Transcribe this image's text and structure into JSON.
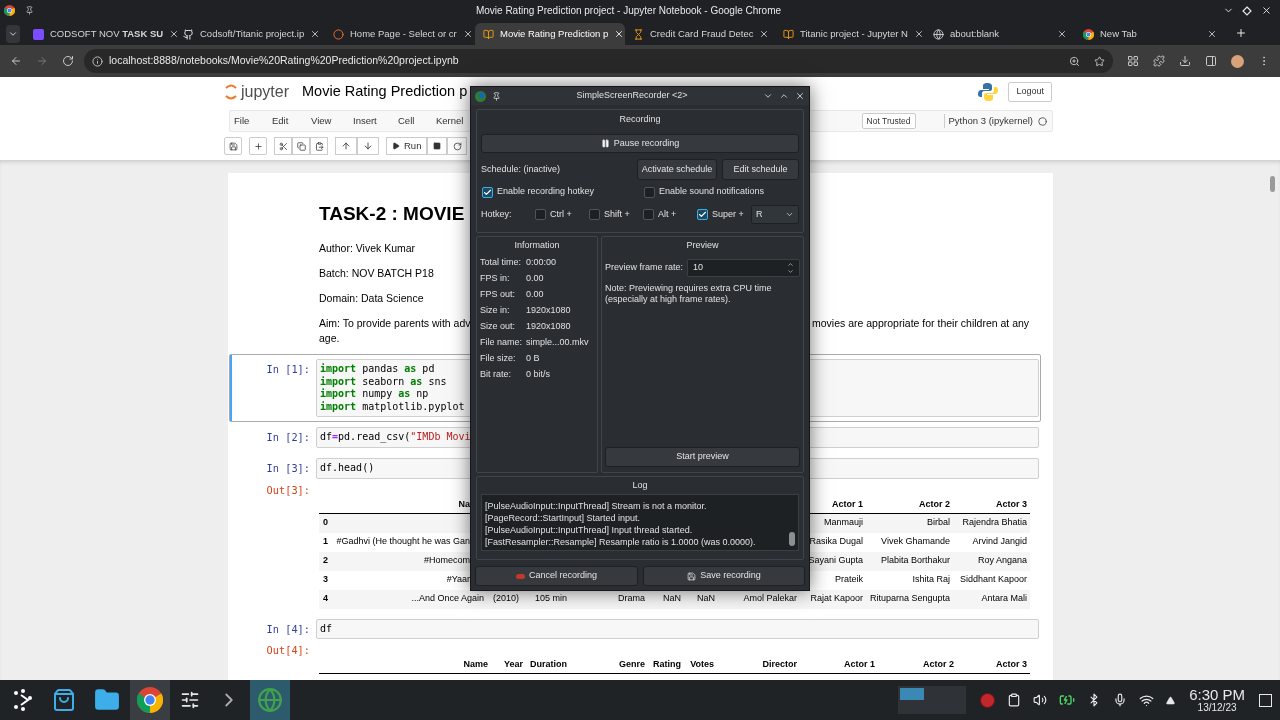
{
  "browser": {
    "window_title": "Movie Rating Prediction project - Jupyter Notebook - Google Chrome",
    "tabs": [
      {
        "title": "CODSOFT NOV **TASK SU**",
        "kind": "page",
        "selected": false
      },
      {
        "title": "Codsoft/Titanic project.ip",
        "kind": "github",
        "selected": false
      },
      {
        "title": "Home Page - Select or cr",
        "kind": "jupyter",
        "selected": false
      },
      {
        "title": "Movie Rating Prediction p",
        "kind": "notebook",
        "selected": true
      },
      {
        "title": "Credit Card Fraud Detec",
        "kind": "hourglass",
        "selected": false
      },
      {
        "title": "Titanic project - Jupyter N",
        "kind": "notebook",
        "selected": false
      },
      {
        "title": "about:blank",
        "kind": "globe",
        "selected": false
      },
      {
        "title": "New Tab",
        "kind": "chrome",
        "selected": false
      }
    ],
    "url": "localhost:8888/notebooks/Movie%20Rating%20Prediction%20project.ipynb"
  },
  "jupyter": {
    "logo": "jupyter",
    "notebook_title": "Movie Rating Prediction p",
    "logout": "Logout",
    "menu": [
      "File",
      "Edit",
      "View",
      "Insert",
      "Cell",
      "Kernel"
    ],
    "trust": "Not Trusted",
    "kernel": "Python 3 (ipykernel)",
    "run": "Run"
  },
  "notebook": {
    "heading": "TASK-2 : MOVIE",
    "paragraphs": [
      "Author: Vivek Kumar",
      "Batch: NOV BATCH P18",
      "Domain: Data Science"
    ],
    "aim": {
      "left": "Aim: To provide parents with adv",
      "right": "movies are appropriate for their children at any",
      "end": "age."
    },
    "cells": [
      {
        "prompt": "In [1]:",
        "selected": true,
        "lines": [
          [
            {
              "text": "import",
              "kind": "keyword"
            },
            {
              "text": " pandas ",
              "kind": "plain"
            },
            {
              "text": "as",
              "kind": "keyword"
            },
            {
              "text": " pd",
              "kind": "plain"
            }
          ],
          [
            {
              "text": "import",
              "kind": "keyword"
            },
            {
              "text": " seaborn ",
              "kind": "plain"
            },
            {
              "text": "as",
              "kind": "keyword"
            },
            {
              "text": " sns",
              "kind": "plain"
            }
          ],
          [
            {
              "text": "import",
              "kind": "keyword"
            },
            {
              "text": " numpy ",
              "kind": "plain"
            },
            {
              "text": "as",
              "kind": "keyword"
            },
            {
              "text": " np",
              "kind": "plain"
            }
          ],
          [
            {
              "text": "import",
              "kind": "keyword"
            },
            {
              "text": " matplotlib.pyplot",
              "kind": "plain"
            }
          ]
        ]
      },
      {
        "prompt": "In [2]:",
        "selected": false,
        "lines": [
          [
            {
              "text": "df",
              "kind": "plain"
            },
            {
              "text": "=",
              "kind": "operator"
            },
            {
              "text": "pd.read_csv(",
              "kind": "plain"
            },
            {
              "text": "\"IMDb Movi",
              "kind": "string"
            }
          ]
        ]
      },
      {
        "prompt": "In [3]:",
        "selected": false,
        "lines": [
          [
            {
              "text": "df.head()",
              "kind": "plain"
            }
          ]
        ],
        "output": {
          "prompt": "Out[3]:",
          "table": {
            "kind": "partial",
            "header_left": "Na",
            "header_right": [
              "Actor 1",
              "Actor 2",
              "Actor 3"
            ],
            "rows": [
              {
                "kind": "covered",
                "index": "0",
                "actors": [
                  "Manmauji",
                  "Birbal",
                  "Rajendra Bhatia"
                ]
              },
              {
                "kind": "covered",
                "index": "1",
                "name": "#Gadhvi (He thought he was Gan",
                "actors": [
                  "Rasika Dugal",
                  "Vivek Ghamande",
                  "Arvind Jangid"
                ]
              },
              {
                "kind": "covered",
                "index": "2",
                "name": "#Homecom",
                "actors": [
                  "Sayani Gupta",
                  "Plabita Borthakur",
                  "Roy Angana"
                ]
              },
              {
                "kind": "covered",
                "index": "3",
                "name": "#Yaar",
                "actors": [
                  "Prateik",
                  "Ishita Raj",
                  "Siddhant Kapoor"
                ]
              },
              {
                "kind": "full",
                "index": "4",
                "cells": [
                  "...And Once Again",
                  "(2010)",
                  "105 min",
                  "Drama",
                  "NaN",
                  "NaN",
                  "Amol Palekar",
                  "Rajat Kapoor",
                  "Rituparna Sengupta",
                  "Antara Mali"
                ]
              }
            ]
          }
        }
      },
      {
        "prompt": "In [4]:",
        "selected": false,
        "lines": [
          [
            {
              "text": "df",
              "kind": "plain"
            }
          ]
        ],
        "output": {
          "prompt": "Out[4]:",
          "table": {
            "kind": "full",
            "header": [
              "Name",
              "Year",
              "Duration",
              "Genre",
              "Rating",
              "Votes",
              "Director",
              "Actor 1",
              "Actor 2",
              "Actor 3"
            ]
          }
        }
      }
    ]
  },
  "recorder": {
    "title": "SimpleScreenRecorder <2>",
    "section": "Recording",
    "pause_button": "Pause recording",
    "schedule_label": "Schedule: (inactive)",
    "schedule_buttons": [
      "Activate schedule",
      "Edit schedule"
    ],
    "options": [
      {
        "label": "Enable recording hotkey",
        "checked": true
      },
      {
        "label": "Enable sound notifications",
        "checked": false
      }
    ],
    "hotkey_label": "Hotkey:",
    "modifiers": [
      {
        "label": "Ctrl +",
        "checked": false
      },
      {
        "label": "Shift +",
        "checked": false
      },
      {
        "label": "Alt +",
        "checked": false
      },
      {
        "label": "Super +",
        "checked": true
      }
    ],
    "key": "R",
    "information": {
      "title": "Information",
      "rows": [
        {
          "label": "Total time:",
          "value": "0:00:00"
        },
        {
          "label": "FPS in:",
          "value": "0.00"
        },
        {
          "label": "FPS out:",
          "value": "0.00"
        },
        {
          "label": "Size in:",
          "value": "1920x1080"
        },
        {
          "label": "Size out:",
          "value": "1920x1080"
        },
        {
          "label": "File name:",
          "value": "simple...00.mkv"
        },
        {
          "label": "File size:",
          "value": "0 B"
        },
        {
          "label": "Bit rate:",
          "value": "0 bit/s"
        }
      ]
    },
    "preview": {
      "title": "Preview",
      "rate_label": "Preview frame rate:",
      "rate": "10",
      "note": "Note: Previewing requires extra CPU time (especially at high frame rates).",
      "button": "Start preview"
    },
    "log": {
      "title": "Log",
      "lines": [
        "[PulseAudioInput::InputThread] Stream is not a monitor.",
        "[PageRecord::StartInput] Started input.",
        "[PulseAudioInput::InputThread] Input thread started.",
        "[FastResampler::Resample] Resample ratio is 1.0000 (was 0.0000)."
      ]
    },
    "cancel_button": "Cancel recording",
    "save_button": "Save recording"
  },
  "taskbar": {
    "time": "6:30 PM",
    "date": "13/12/23"
  }
}
